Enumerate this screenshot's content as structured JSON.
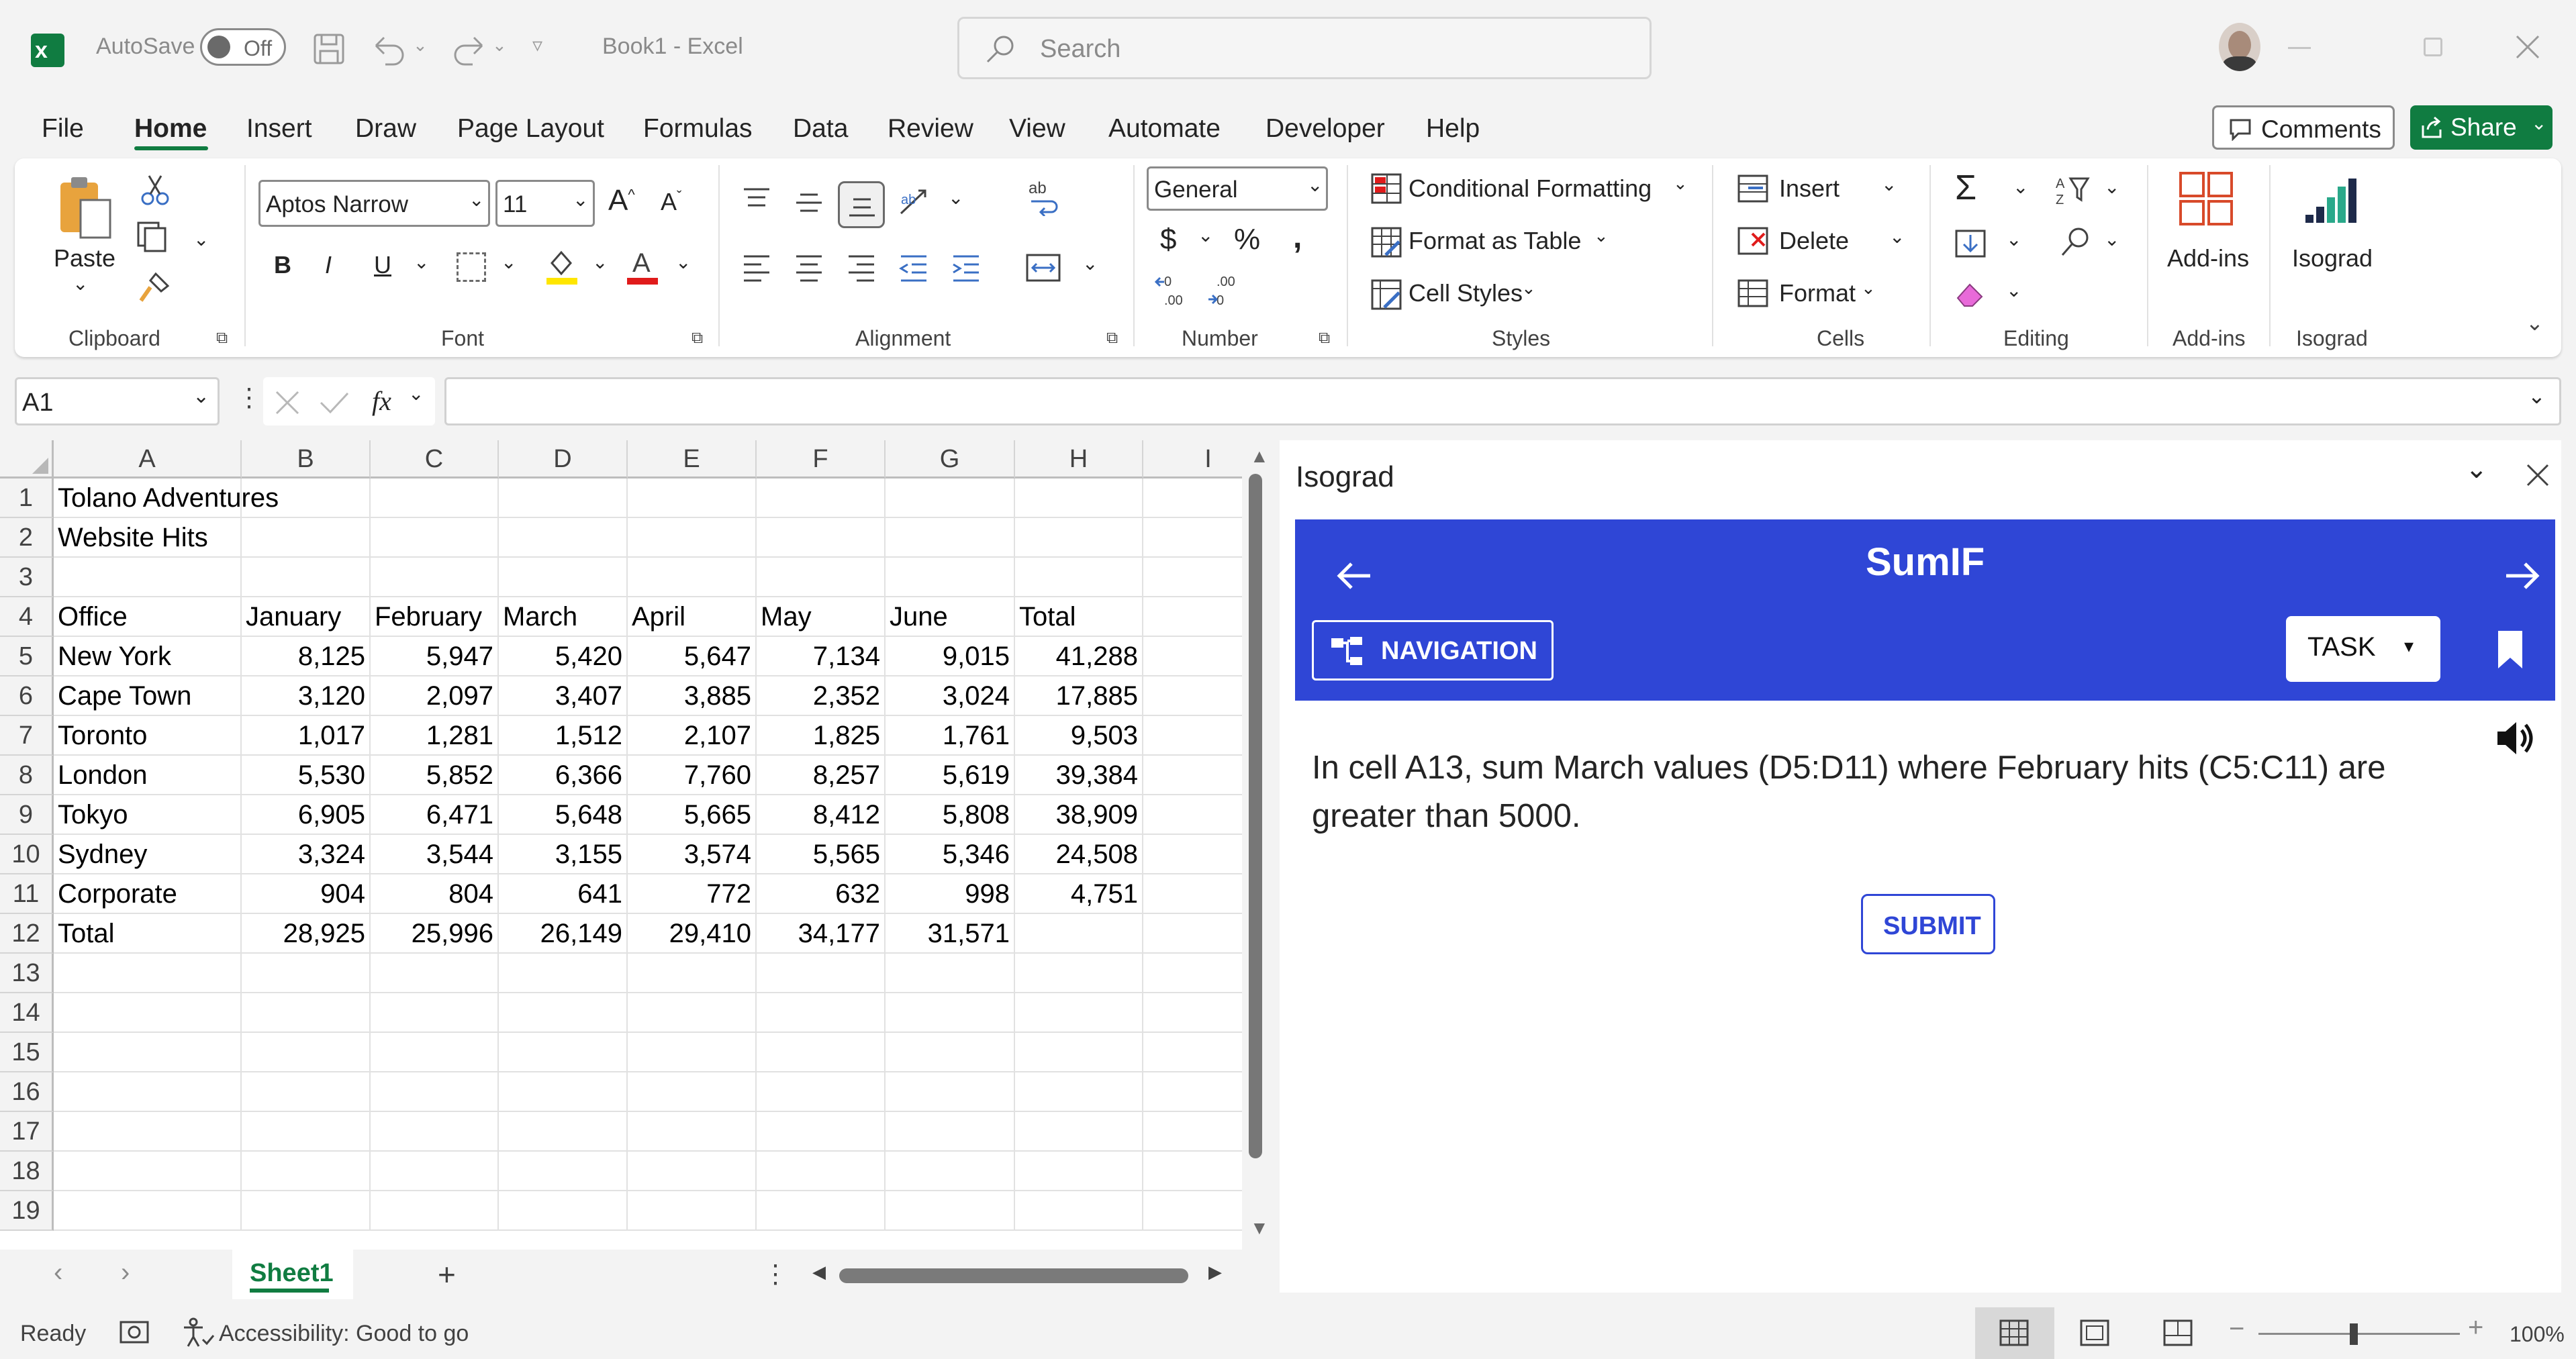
{
  "titlebar": {
    "autosave_label": "AutoSave",
    "autosave_state": "Off",
    "doc_title": "Book1  -  Excel",
    "search_placeholder": "Search"
  },
  "menu": {
    "items": [
      "File",
      "Home",
      "Insert",
      "Draw",
      "Page Layout",
      "Formulas",
      "Data",
      "Review",
      "View",
      "Automate",
      "Developer",
      "Help"
    ],
    "active": "Home",
    "comments_label": "Comments",
    "share_label": "Share"
  },
  "ribbon": {
    "clipboard": {
      "paste_label": "Paste",
      "group_label": "Clipboard"
    },
    "font": {
      "font_name": "Aptos Narrow",
      "font_size": "11",
      "group_label": "Font"
    },
    "alignment": {
      "group_label": "Alignment"
    },
    "number": {
      "format": "General",
      "group_label": "Number"
    },
    "styles": {
      "conditional_formatting": "Conditional Formatting",
      "format_as_table": "Format as Table",
      "cell_styles": "Cell Styles",
      "group_label": "Styles"
    },
    "cells": {
      "insert": "Insert",
      "delete": "Delete",
      "format": "Format",
      "group_label": "Cells"
    },
    "editing": {
      "group_label": "Editing"
    },
    "addins": {
      "label": "Add-ins",
      "group_label": "Add-ins"
    },
    "isograd": {
      "label": "Isograd",
      "group_label": "Isograd"
    }
  },
  "formula_bar": {
    "name_box": "A1",
    "formula": ""
  },
  "sheet": {
    "columns": [
      "A",
      "B",
      "C",
      "D",
      "E",
      "F",
      "G",
      "H",
      "I"
    ],
    "rows": [
      [
        "Tolano Adventures",
        "",
        "",
        "",
        "",
        "",
        "",
        ""
      ],
      [
        "Website Hits",
        "",
        "",
        "",
        "",
        "",
        "",
        ""
      ],
      [
        "",
        "",
        "",
        "",
        "",
        "",
        "",
        ""
      ],
      [
        "Office",
        "January",
        "February",
        "March",
        "April",
        "May",
        "June",
        "Total"
      ],
      [
        "New York",
        "8,125",
        "5,947",
        "5,420",
        "5,647",
        "7,134",
        "9,015",
        "41,288"
      ],
      [
        "Cape Town",
        "3,120",
        "2,097",
        "3,407",
        "3,885",
        "2,352",
        "3,024",
        "17,885"
      ],
      [
        "Toronto",
        "1,017",
        "1,281",
        "1,512",
        "2,107",
        "1,825",
        "1,761",
        "9,503"
      ],
      [
        "London",
        "5,530",
        "5,852",
        "6,366",
        "7,760",
        "8,257",
        "5,619",
        "39,384"
      ],
      [
        "Tokyo",
        "6,905",
        "6,471",
        "5,648",
        "5,665",
        "8,412",
        "5,808",
        "38,909"
      ],
      [
        "Sydney",
        "3,324",
        "3,544",
        "3,155",
        "3,574",
        "5,565",
        "5,346",
        "24,508"
      ],
      [
        "Corporate",
        "904",
        "804",
        "641",
        "772",
        "632",
        "998",
        "4,751"
      ],
      [
        "Total",
        "28,925",
        "25,996",
        "26,149",
        "29,410",
        "34,177",
        "31,571",
        ""
      ],
      [
        "",
        "",
        "",
        "",
        "",
        "",
        "",
        ""
      ],
      [
        "",
        "",
        "",
        "",
        "",
        "",
        "",
        ""
      ],
      [
        "",
        "",
        "",
        "",
        "",
        "",
        "",
        ""
      ],
      [
        "",
        "",
        "",
        "",
        "",
        "",
        "",
        ""
      ],
      [
        "",
        "",
        "",
        "",
        "",
        "",
        "",
        ""
      ],
      [
        "",
        "",
        "",
        "",
        "",
        "",
        "",
        ""
      ],
      [
        "",
        "",
        "",
        "",
        "",
        "",
        "",
        ""
      ]
    ],
    "row_numbers": [
      "1",
      "2",
      "3",
      "4",
      "5",
      "6",
      "7",
      "8",
      "9",
      "10",
      "11",
      "12",
      "13",
      "14",
      "15",
      "16",
      "17",
      "18",
      "19"
    ],
    "tab_name": "Sheet1"
  },
  "statusbar": {
    "ready": "Ready",
    "accessibility": "Accessibility: Good to go",
    "zoom": "100%"
  },
  "pane": {
    "title": "Isograd",
    "task_title": "SumIF",
    "navigation_label": "NAVIGATION",
    "task_label": "TASK",
    "instruction": "In cell A13, sum March values (D5:D11) where February hits (C5:C11) are greater than 5000.",
    "submit_label": "SUBMIT",
    "accent_color": "#2f46d6"
  }
}
